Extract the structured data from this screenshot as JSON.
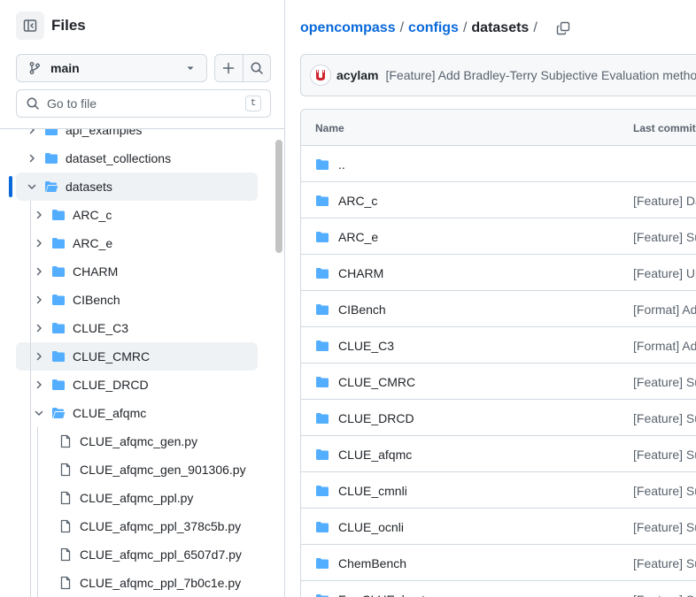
{
  "sidebar": {
    "title": "Files",
    "branch": "main",
    "search": {
      "placeholder": "Go to file",
      "shortcut": "t"
    },
    "tree": [
      {
        "label": "api_examples",
        "type": "folder",
        "depth": 0,
        "expanded": false
      },
      {
        "label": "dataset_collections",
        "type": "folder",
        "depth": 0,
        "expanded": false
      },
      {
        "label": "datasets",
        "type": "folder",
        "depth": 0,
        "expanded": true,
        "selected": true
      },
      {
        "label": "ARC_c",
        "type": "folder",
        "depth": 1,
        "expanded": false
      },
      {
        "label": "ARC_e",
        "type": "folder",
        "depth": 1,
        "expanded": false
      },
      {
        "label": "CHARM",
        "type": "folder",
        "depth": 1,
        "expanded": false
      },
      {
        "label": "CIBench",
        "type": "folder",
        "depth": 1,
        "expanded": false
      },
      {
        "label": "CLUE_C3",
        "type": "folder",
        "depth": 1,
        "expanded": false
      },
      {
        "label": "CLUE_CMRC",
        "type": "folder",
        "depth": 1,
        "expanded": false,
        "hover": true
      },
      {
        "label": "CLUE_DRCD",
        "type": "folder",
        "depth": 1,
        "expanded": false
      },
      {
        "label": "CLUE_afqmc",
        "type": "folder",
        "depth": 1,
        "expanded": true
      },
      {
        "label": "CLUE_afqmc_gen.py",
        "type": "file",
        "depth": 2
      },
      {
        "label": "CLUE_afqmc_gen_901306.py",
        "type": "file",
        "depth": 2
      },
      {
        "label": "CLUE_afqmc_ppl.py",
        "type": "file",
        "depth": 2
      },
      {
        "label": "CLUE_afqmc_ppl_378c5b.py",
        "type": "file",
        "depth": 2
      },
      {
        "label": "CLUE_afqmc_ppl_6507d7.py",
        "type": "file",
        "depth": 2
      },
      {
        "label": "CLUE_afqmc_ppl_7b0c1e.py",
        "type": "file",
        "depth": 2
      }
    ]
  },
  "breadcrumb": {
    "repo": "opencompass",
    "dir1": "configs",
    "current": "datasets",
    "sep": "/"
  },
  "commit": {
    "author": "acylam",
    "message": "[Feature] Add Bradley-Terry Subjective Evaluation method"
  },
  "table": {
    "headers": {
      "name": "Name",
      "last_commit": "Last commit message"
    },
    "rows": [
      {
        "name": "..",
        "message": ""
      },
      {
        "name": "ARC_c",
        "message": "[Feature] Dataset"
      },
      {
        "name": "ARC_e",
        "message": "[Feature] Support"
      },
      {
        "name": "CHARM",
        "message": "[Feature] Update"
      },
      {
        "name": "CIBench",
        "message": "[Format] Add"
      },
      {
        "name": "CLUE_C3",
        "message": "[Format] Add"
      },
      {
        "name": "CLUE_CMRC",
        "message": "[Feature] Support"
      },
      {
        "name": "CLUE_DRCD",
        "message": "[Feature] Support"
      },
      {
        "name": "CLUE_afqmc",
        "message": "[Feature] Support"
      },
      {
        "name": "CLUE_cmnli",
        "message": "[Feature] Support"
      },
      {
        "name": "CLUE_ocnli",
        "message": "[Feature] Support"
      },
      {
        "name": "ChemBench",
        "message": "[Feature] Support"
      },
      {
        "name": "FewCLUE_bustm",
        "message": "[Feature] Support"
      }
    ]
  },
  "colors": {
    "link": "#0969da",
    "folder": "#54aeff",
    "accent": "#0969da",
    "border": "#d1d9e0"
  }
}
